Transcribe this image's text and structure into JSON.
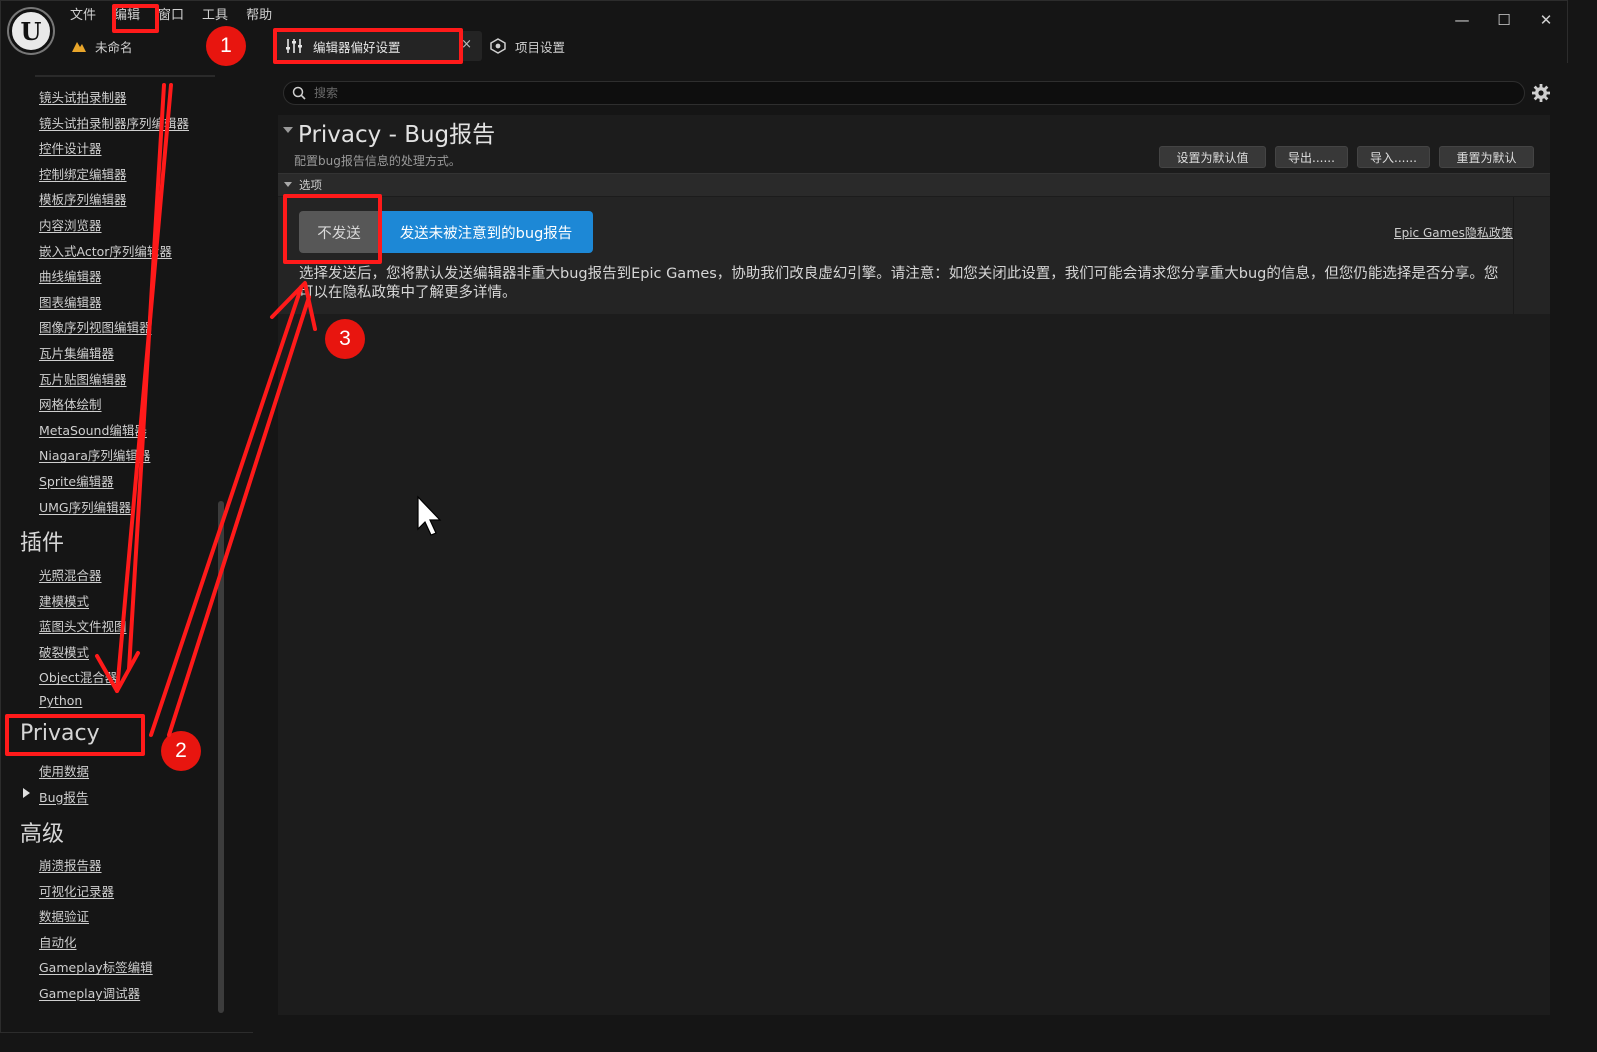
{
  "app": {
    "logo_text": "U",
    "menu": [
      "文件",
      "编辑",
      "窗口",
      "工具",
      "帮助"
    ],
    "project_name": "未命名",
    "window_controls": {
      "minimize": "—",
      "maximize": "☐",
      "close": "✕"
    }
  },
  "tabs": {
    "active_label": "编辑器偏好设置",
    "close_glyph": "×",
    "inactive_label": "项目设置"
  },
  "sidebar": {
    "links_top": [
      "镜头试拍录制器",
      "镜头试拍录制器序列编辑器",
      "控件设计器",
      "控制绑定编辑器",
      "模板序列编辑器",
      "内容浏览器",
      "嵌入式Actor序列编辑器",
      "曲线编辑器",
      "图表编辑器",
      "图像序列视图编辑器",
      "瓦片集编辑器",
      "瓦片贴图编辑器",
      "网格体绘制",
      "MetaSound编辑器",
      "Niagara序列编辑器",
      "Sprite编辑器",
      "UMG序列编辑器"
    ],
    "cat_plugins": "插件",
    "links_plugins": [
      "光照混合器",
      "建模模式",
      "蓝图头文件视图",
      "破裂模式",
      "Object混合器",
      "Python"
    ],
    "cat_privacy": "Privacy",
    "links_privacy": [
      "使用数据",
      "Bug报告"
    ],
    "cat_advanced": "高级",
    "links_advanced": [
      "崩溃报告器",
      "可视化记录器",
      "数据验证",
      "自动化",
      "Gameplay标签编辑",
      "Gameplay调试器"
    ]
  },
  "search": {
    "placeholder": "搜索"
  },
  "section": {
    "title": "Privacy - Bug报告",
    "description": "配置bug报告信息的处理方式。",
    "buttons": [
      "设置为默认值",
      "导出......",
      "导入......",
      "重置为默认"
    ],
    "category": "选项",
    "option_off": "不发送",
    "option_on": "发送未被注意到的bug报告",
    "privacy_link": "Epic Games隐私政策",
    "option_description": "选择发送后，您将默认发送编辑器非重大bug报告到Epic Games，协助我们改良虚幻引擎。请注意：如您关闭此设置，我们可能会请求您分享重大bug的信息，但您仍能选择是否分享。您可以在隐私政策中了解更多详情。"
  },
  "annotations": {
    "badges": [
      "1",
      "2",
      "3"
    ],
    "color": "#ff1a1a"
  },
  "colors": {
    "accent": "#1d88d6",
    "background": "#151515",
    "panel": "#1c1c1c"
  }
}
